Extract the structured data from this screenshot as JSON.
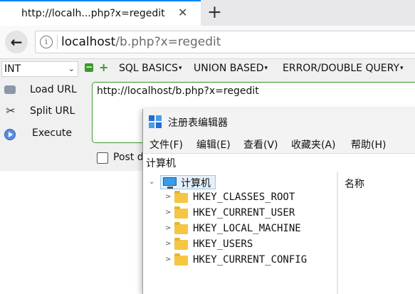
{
  "browser": {
    "tab_title": "http://localh...php?x=regedit",
    "tab_close": "✕",
    "new_tab": "+",
    "back": "←",
    "info": "i",
    "url_host": "localhost",
    "url_path": "/b.php?x=regedit"
  },
  "hackbar": {
    "select_value": "INT",
    "menus": [
      "SQL BASICS",
      "UNION BASED",
      "ERROR/DOUBLE QUERY"
    ],
    "load_url": "Load URL",
    "split_url": "Split URL",
    "execute": "Execute",
    "textarea_value": "http://localhost/b.php?x=regedit",
    "post_label": "Post d"
  },
  "regedit": {
    "title": "注册表编辑器",
    "menus": [
      "文件(F)",
      "编辑(E)",
      "查看(V)",
      "收藏夹(A)",
      "帮助(H)"
    ],
    "address": "计算机",
    "root": "计算机",
    "column_name": "名称",
    "keys": [
      "HKEY_CLASSES_ROOT",
      "HKEY_CURRENT_USER",
      "HKEY_LOCAL_MACHINE",
      "HKEY_USERS",
      "HKEY_CURRENT_CONFIG"
    ]
  }
}
